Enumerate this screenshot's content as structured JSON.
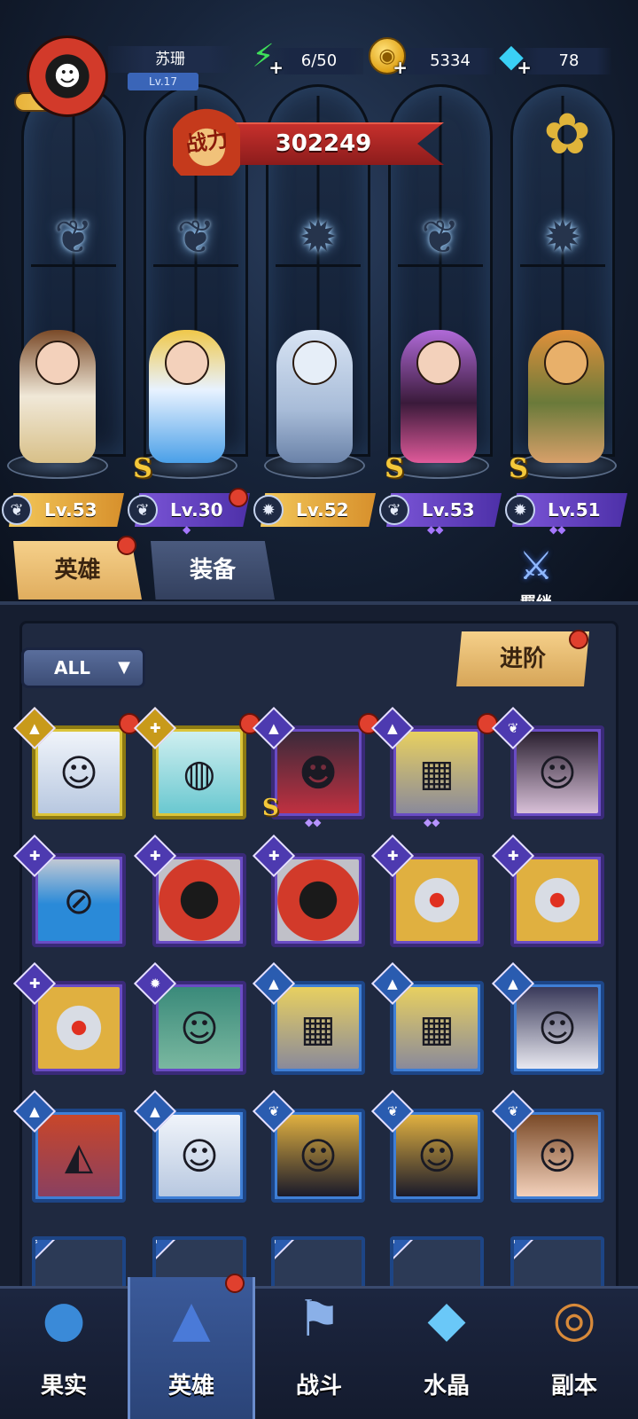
{
  "player": {
    "name": "苏珊",
    "level": "Lv.17"
  },
  "resources": {
    "energy": "6/50",
    "coins": "5334",
    "gems": "78"
  },
  "power": {
    "label": "战力",
    "value": "302249"
  },
  "lineup": [
    {
      "level": "Lv.53",
      "tag_color": "gold",
      "class_icon": "wing-icon",
      "s_rank": false
    },
    {
      "level": "Lv.30",
      "tag_color": "purple",
      "class_icon": "wing-icon",
      "s_rank": true,
      "alert": true
    },
    {
      "level": "Lv.52",
      "tag_color": "gold",
      "class_icon": "claw-icon",
      "s_rank": false
    },
    {
      "level": "Lv.53",
      "tag_color": "purple",
      "class_icon": "wing-icon",
      "s_rank": true
    },
    {
      "level": "Lv.51",
      "tag_color": "purple",
      "class_icon": "claw-icon",
      "s_rank": true
    }
  ],
  "tabs": {
    "heroes": "英雄",
    "equipment": "装备"
  },
  "bond_label": "羁绊",
  "filter": {
    "selected": "ALL"
  },
  "advance_label": "进阶",
  "roster_colors": {
    "gold": "#dcc53a",
    "purple": "#6a4cc4",
    "blue": "#3f7fd6"
  },
  "nav": {
    "fruit": "果实",
    "heroes": "英雄",
    "battle": "战斗",
    "crystal": "水晶",
    "dungeon": "副本"
  }
}
